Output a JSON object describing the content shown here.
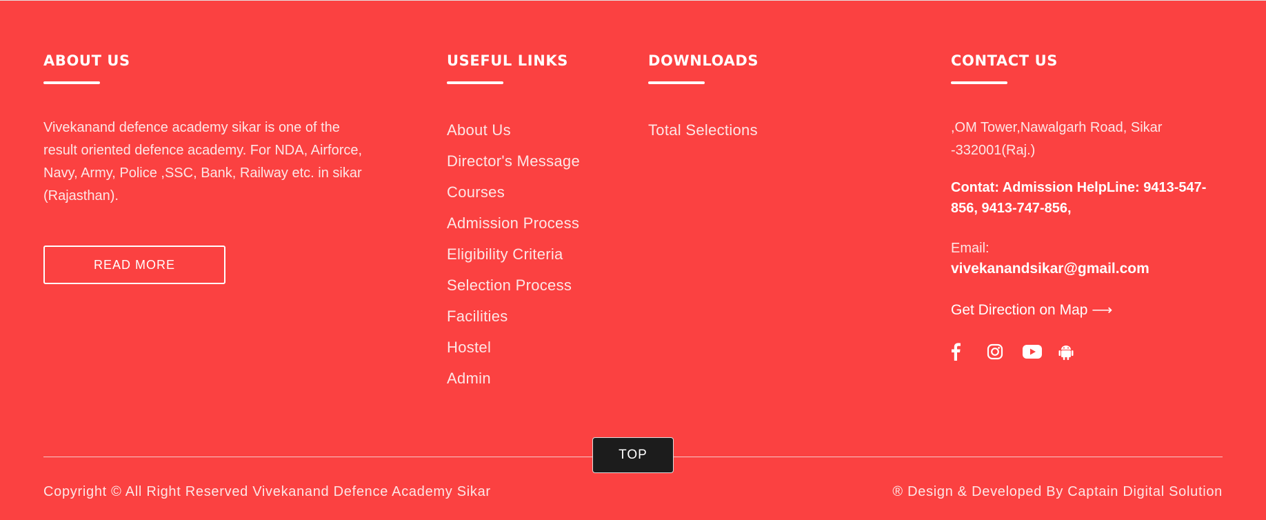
{
  "colors": {
    "background": "#fb4141",
    "top_button": "#1c1c1c",
    "text": "#ffffff"
  },
  "about": {
    "heading": "ABOUT US",
    "text": "Vivekanand defence academy sikar is one of the result oriented defence academy. For NDA, Airforce, Navy, Army, Police ,SSC, Bank, Railway etc. in sikar (Rajasthan).",
    "button_label": "READ MORE"
  },
  "useful_links": {
    "heading": "USEFUL LINKS",
    "items": [
      "About Us",
      "Director's Message",
      "Courses",
      "Admission Process",
      "Eligibility Criteria",
      "Selection Process",
      "Facilities",
      "Hostel",
      "Admin"
    ]
  },
  "downloads": {
    "heading": "DOWNLOADS",
    "items": [
      "Total Selections"
    ]
  },
  "contact": {
    "heading": "CONTACT US",
    "address": ",OM Tower,Nawalgarh Road, Sikar -332001(Raj.)",
    "phone": "Contat: Admission HelpLine: 9413-547-856, 9413-747-856,",
    "email_label": "Email:",
    "email": "vivekanandsikar@gmail.com",
    "direction": "Get Direction on Map ⟶",
    "social_icons": [
      "facebook-icon",
      "instagram-icon",
      "youtube-icon",
      "android-icon"
    ]
  },
  "footer": {
    "top_label": "TOP",
    "copyright": "Copyright ©  All Right Reserved Vivekanand Defence Academy Sikar",
    "credit": "® Design & Developed By Captain Digital Solution"
  }
}
